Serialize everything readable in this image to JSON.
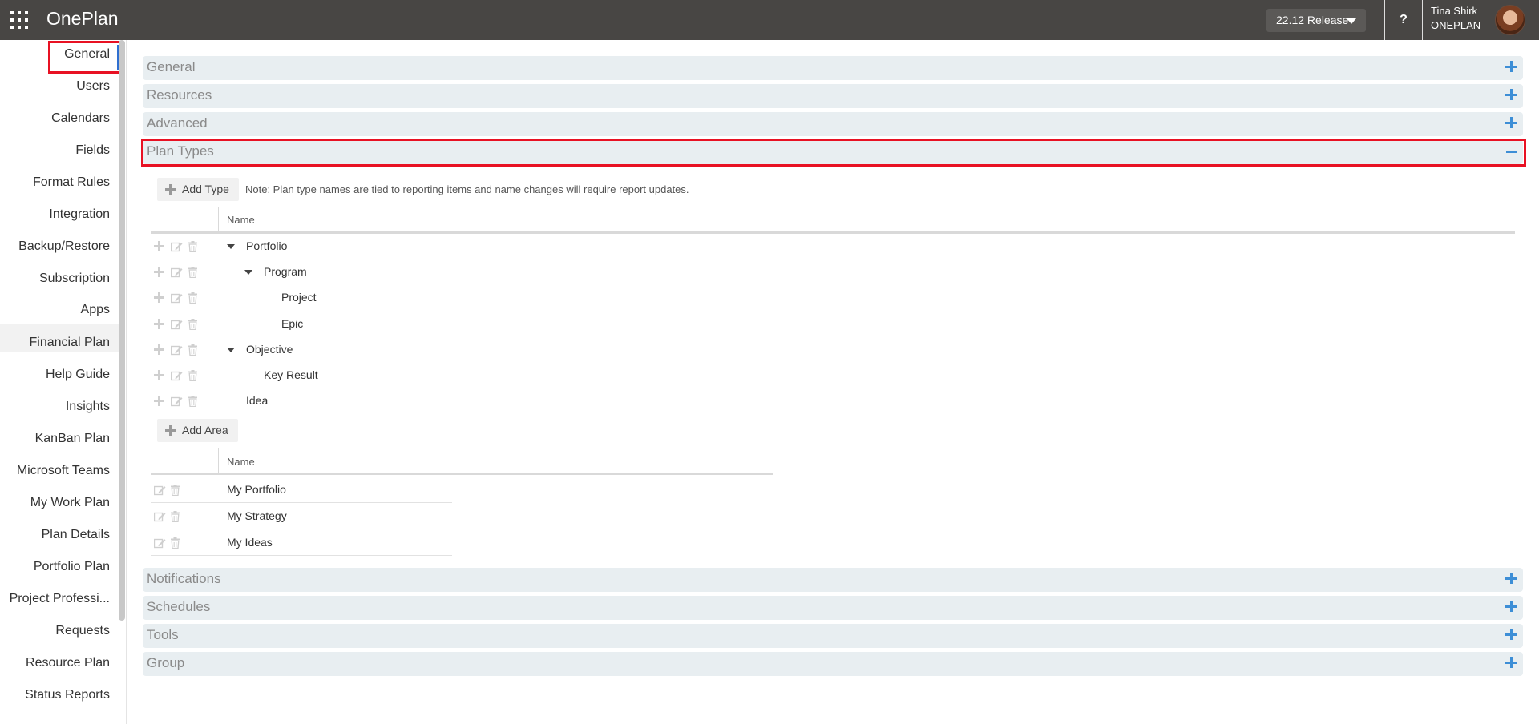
{
  "topbar": {
    "app_name": "OnePlan",
    "release_label": "22.12 Release",
    "help_label": "?",
    "user_name": "Tina Shirk",
    "user_org": "ONEPLAN"
  },
  "leftnav": {
    "items": [
      {
        "label": "General"
      },
      {
        "label": "Users"
      },
      {
        "label": "Calendars"
      },
      {
        "label": "Fields"
      },
      {
        "label": "Format Rules"
      },
      {
        "label": "Integration"
      },
      {
        "label": "Backup/Restore"
      },
      {
        "label": "Subscription"
      },
      {
        "label": "Apps"
      },
      {
        "label": "Financial Plan"
      },
      {
        "label": "Help Guide"
      },
      {
        "label": "Insights"
      },
      {
        "label": "KanBan Plan"
      },
      {
        "label": "Microsoft Teams"
      },
      {
        "label": "My Work Plan"
      },
      {
        "label": "Plan Details"
      },
      {
        "label": "Portfolio Plan"
      },
      {
        "label": "Project Professi..."
      },
      {
        "label": "Requests"
      },
      {
        "label": "Resource Plan"
      },
      {
        "label": "Status Reports"
      }
    ]
  },
  "sections": {
    "general": "General",
    "resources": "Resources",
    "advanced": "Advanced",
    "plan_types": "Plan Types",
    "notifications": "Notifications",
    "schedules": "Schedules",
    "tools": "Tools",
    "group": "Group"
  },
  "plan_types": {
    "add_type_label": "Add Type",
    "note": "Note: Plan type names are tied to reporting items and name changes will require report updates.",
    "name_header": "Name",
    "types": [
      {
        "name": "Portfolio",
        "level": 0,
        "expanded": true
      },
      {
        "name": "Program",
        "level": 1,
        "expanded": true
      },
      {
        "name": "Project",
        "level": 2
      },
      {
        "name": "Epic",
        "level": 2
      },
      {
        "name": "Objective",
        "level": 0,
        "expanded": true
      },
      {
        "name": "Key Result",
        "level": 1
      },
      {
        "name": "Idea",
        "level": 0
      }
    ],
    "add_area_label": "Add Area",
    "area_name_header": "Name",
    "areas": [
      {
        "name": "My Portfolio"
      },
      {
        "name": "My Strategy"
      },
      {
        "name": "My Ideas"
      }
    ]
  },
  "colors": {
    "topbar": "#484644",
    "accent": "#3d8ed6",
    "highlight": "#e81123",
    "section_bg": "#e8eef1"
  }
}
